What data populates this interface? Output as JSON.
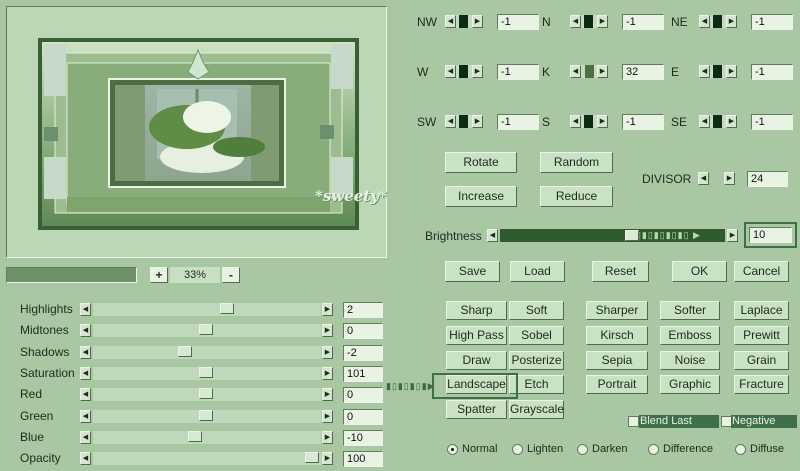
{
  "matrix": [
    {
      "label": "NW",
      "value": "-1"
    },
    {
      "label": "N",
      "value": "-1"
    },
    {
      "label": "NE",
      "value": "-1"
    },
    {
      "label": "W",
      "value": "-1"
    },
    {
      "label": "K",
      "value": "32"
    },
    {
      "label": "E",
      "value": "-1"
    },
    {
      "label": "SW",
      "value": "-1"
    },
    {
      "label": "S",
      "value": "-1"
    },
    {
      "label": "SE",
      "value": "-1"
    }
  ],
  "actions": {
    "rotate": "Rotate",
    "random": "Random",
    "increase": "Increase",
    "reduce": "Reduce"
  },
  "divisor": {
    "label": "DIVISOR",
    "value": "24"
  },
  "brightness": {
    "label": "Brightness",
    "value": "10",
    "level": 0.6
  },
  "zoom": {
    "plus": "+",
    "value": "33%",
    "minus": "-"
  },
  "watermark": "*sweety*",
  "sliders": [
    {
      "label": "Highlights",
      "value": "2",
      "level": 0.6
    },
    {
      "label": "Midtones",
      "value": "0",
      "level": 0.5
    },
    {
      "label": "Shadows",
      "value": "-2",
      "level": 0.4
    },
    {
      "label": "Saturation",
      "value": "101",
      "level": 0.5
    },
    {
      "label": "Red",
      "value": "0",
      "level": 0.5
    },
    {
      "label": "Green",
      "value": "0",
      "level": 0.5
    },
    {
      "label": "Blue",
      "value": "-10",
      "level": 0.45
    },
    {
      "label": "Opacity",
      "value": "100",
      "level": 1.0
    }
  ],
  "file_buttons": {
    "save": "Save",
    "load": "Load",
    "reset": "Reset",
    "ok": "OK",
    "cancel": "Cancel"
  },
  "presets": [
    [
      "Sharp",
      "Soft",
      "Sharper",
      "Softer",
      "Laplace"
    ],
    [
      "High Pass",
      "Sobel",
      "Kirsch",
      "Emboss",
      "Prewitt"
    ],
    [
      "Draw",
      "Posterize",
      "Sepia",
      "Noise",
      "Grain"
    ],
    [
      "Landscape",
      "Etch",
      "Portrait",
      "Graphic",
      "Fracture"
    ],
    [
      "Spatter",
      "Grayscale"
    ]
  ],
  "options": {
    "blend_last": "Blend Last",
    "negative": "Negative"
  },
  "modes": [
    "Normal",
    "Lighten",
    "Darken",
    "Difference",
    "Diffuse"
  ],
  "selected_mode": "Normal",
  "colors": {
    "panel": "#a9c7a3",
    "button": "#c9e2c3",
    "field": "#e8f3e4",
    "dark": "#0f2a12"
  }
}
